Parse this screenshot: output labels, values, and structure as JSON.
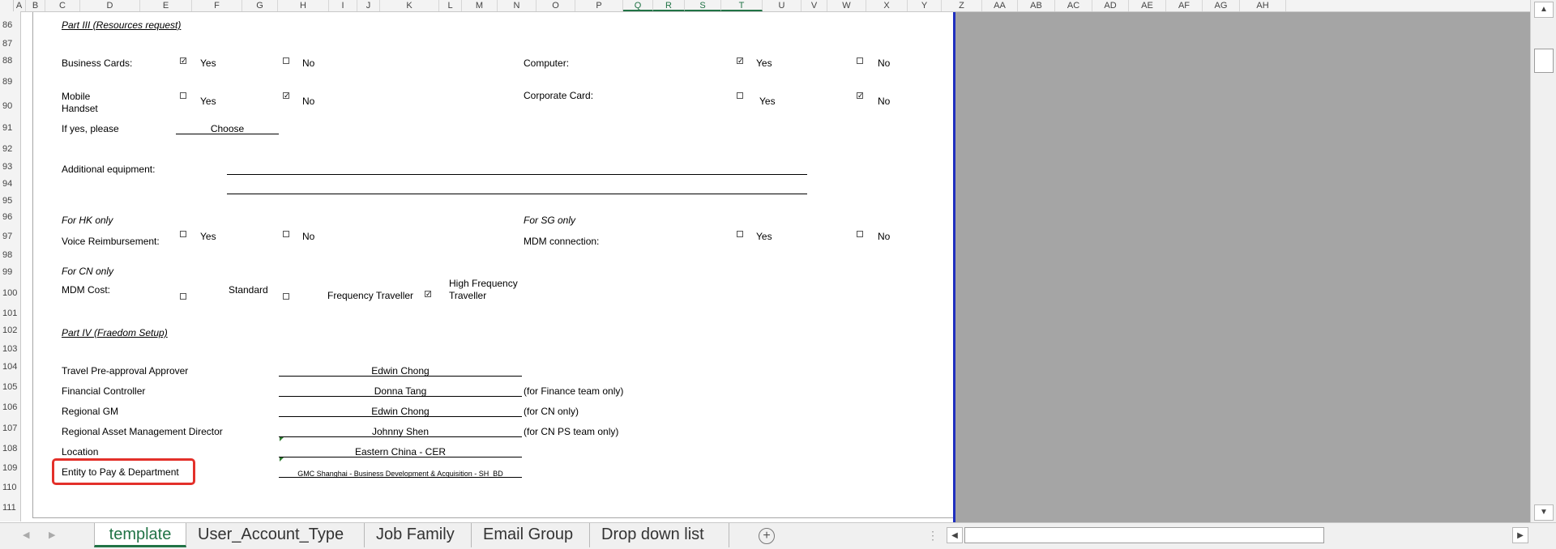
{
  "columns": [
    "A",
    "B",
    "C",
    "D",
    "E",
    "F",
    "G",
    "H",
    "I",
    "J",
    "K",
    "L",
    "M",
    "N",
    "O",
    "P",
    "Q",
    "R",
    "S",
    "T",
    "U",
    "V",
    "W",
    "X",
    "Y",
    "Z",
    "AA",
    "AB",
    "AC",
    "AD",
    "AE",
    "AF",
    "AG",
    "AH"
  ],
  "rows": [
    "86",
    "87",
    "88",
    "89",
    "90",
    "91",
    "92",
    "93",
    "94",
    "95",
    "96",
    "97",
    "98",
    "99",
    "100",
    "101",
    "102",
    "103",
    "104",
    "105",
    "106",
    "107",
    "108",
    "109",
    "110",
    "111"
  ],
  "part3": {
    "heading": "Part III (Resources request)",
    "business_cards": "Business Cards:",
    "computer": "Computer:",
    "mobile_line1": "Mobile",
    "mobile_line2": "Handset",
    "corporate_card": "Corporate Card:",
    "yes": "Yes",
    "no": "No",
    "if_yes": "If yes, please",
    "choose": "Choose",
    "additional_equipment": "Additional equipment:",
    "for_hk": "For HK only",
    "voice_reimb": "Voice Reimbursement:",
    "for_sg": "For SG only",
    "mdm_connection": "MDM connection:",
    "for_cn": "For CN only",
    "mdm_cost": "MDM Cost:",
    "standard": "Standard",
    "frequency_traveller": "Frequency  Traveller",
    "hf_line1": "High Frequency",
    "hf_line2": "Traveller",
    "check_mark": "✓"
  },
  "part4": {
    "heading": "Part IV (Fraedom Setup)",
    "travel_approver_label": "Travel Pre-approval Approver",
    "travel_approver_value": "Edwin Chong",
    "financial_controller_label": "Financial Controller",
    "financial_controller_value": "Donna Tang",
    "financial_controller_note": "(for Finance team only)",
    "regional_gm_label": "Regional GM",
    "regional_gm_value": "Edwin Chong",
    "regional_gm_note": "(for CN only)",
    "asset_mgmt_label": "Regional Asset Management Director",
    "asset_mgmt_value": "Johnny Shen",
    "asset_mgmt_note": "(for CN PS team only)",
    "location_label": "Location",
    "location_value": "Eastern China - CER",
    "entity_label": "Entity to Pay & Department",
    "entity_value": "GMC Shanghai - Business Development & Acquisition - SH_BD"
  },
  "tabs": [
    "template",
    "User_Account_Type",
    "Job Family",
    "Email Group",
    "Drop down list"
  ],
  "active_tab": "template",
  "icons": {
    "add_sheet": "+",
    "scroll_up": "▲",
    "scroll_down": "▼",
    "scroll_left": "◀",
    "scroll_right": "▶",
    "tab_prev": "◀",
    "tab_next": "▶",
    "split": "⋮"
  },
  "colors": {
    "accent": "#217346",
    "highlight": "#e3302a",
    "frame": "#1f2fbf",
    "gray_area": "#a5a5a5"
  }
}
